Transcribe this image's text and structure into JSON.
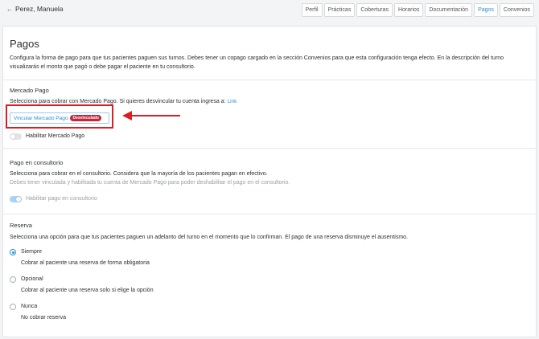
{
  "header": {
    "back_icon": "←",
    "patient_name": "Perez, Manuela",
    "tabs": [
      {
        "label": "Perfil"
      },
      {
        "label": "Prácticas"
      },
      {
        "label": "Coberturas"
      },
      {
        "label": "Horarios"
      },
      {
        "label": "Documentación"
      },
      {
        "label": "Pagos"
      },
      {
        "label": "Convenios"
      }
    ],
    "active_tab": "Pagos"
  },
  "page": {
    "title": "Pagos",
    "intro": "Configura la forma de pago para que tus pacientes paguen sus turnos. Debes tener un copago cargado en la sección Convenios para que esta configuración tenga efecto. En la descripción del turno visualizarás el monto que pagó o debe pagar el paciente en tu consultorio."
  },
  "mercado_pago": {
    "title": "Mercado Pago",
    "description": "Selecciona para cobrar con Mercado Pago. Si quieres desvincular tu cuenta ingresa a:",
    "link_label": "Link",
    "button_label": "Vincular Mercado Pago",
    "badge_label": "Desvinculado",
    "toggle_label": "Habilitar Mercado Pago",
    "toggle_on": false
  },
  "consultorio": {
    "title": "Pago en consultorio",
    "description": "Selecciona para cobrar en el consultorio. Considera que la mayoría de los pacientes pagan en efectivo.",
    "note": "Debes tener vinculada y habilitada tu cuenta de Mercado Pago para poder deshabilitar el pago en el consultorio.",
    "toggle_label": "Habilitar pago en consultorio",
    "toggle_on": true
  },
  "reserva": {
    "title": "Reserva",
    "description": "Selecciona una opción para que tus pacientes paguen un adelanto del turno en el momento que lo confirman. El pago de una reserva disminuye el ausentismo.",
    "options": [
      {
        "label": "Siempre",
        "description": "Cobrar al paciente una reserva de forma obligatoria",
        "checked": true
      },
      {
        "label": "Opcional",
        "description": "Cobrar al paciente una reserva solo si elige la opción",
        "checked": false
      },
      {
        "label": "Nunca",
        "description": "No cobrar reserva",
        "checked": false
      }
    ]
  },
  "colors": {
    "accent": "#2f8fd8",
    "badge": "#c3263d",
    "highlight": "#d91f25"
  }
}
